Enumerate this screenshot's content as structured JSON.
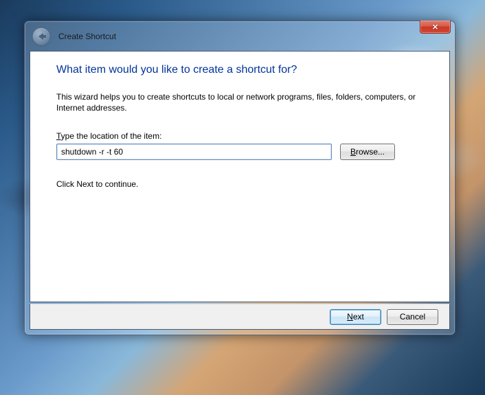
{
  "window": {
    "wizard_title": "Create Shortcut"
  },
  "content": {
    "heading": "What item would you like to create a shortcut for?",
    "description": "This wizard helps you to create shortcuts to local or network programs, files, folders, computers, or Internet addresses.",
    "location_label_prefix": "T",
    "location_label_rest": "ype the location of the item:",
    "location_value": "shutdown -r -t 60",
    "browse_prefix": "B",
    "browse_rest": "rowse...",
    "continue_text": "Click Next to continue."
  },
  "footer": {
    "next_prefix": "N",
    "next_rest": "ext",
    "cancel": "Cancel"
  }
}
